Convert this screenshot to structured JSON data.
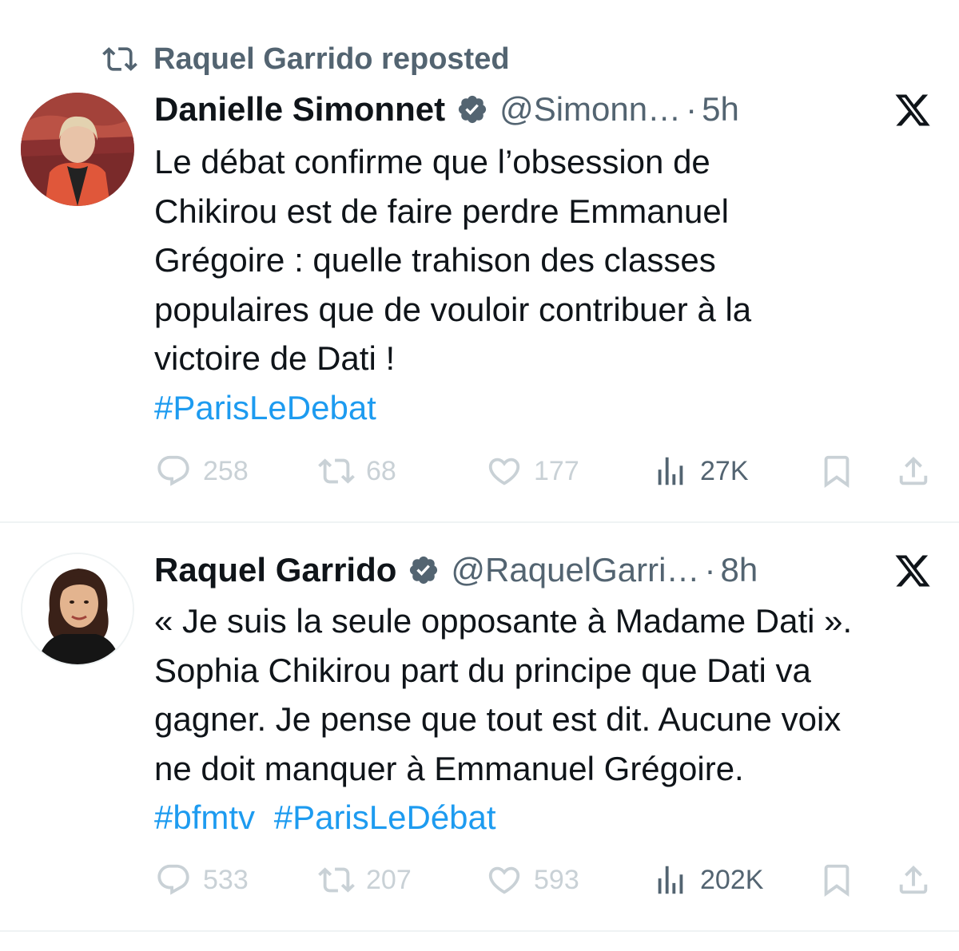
{
  "repost_banner": {
    "text": "Raquel Garrido reposted",
    "icon": "repost-icon"
  },
  "tweets": [
    {
      "author_name": "Danielle Simonnet",
      "handle": "@Simonn…",
      "separator": "·",
      "time": "5h",
      "verified": true,
      "lines": [
        "Le débat confirme que l’obsession de",
        "Chikirou est de faire perdre Emmanuel",
        "Grégoire : quelle trahison des classes",
        "populaires que de vouloir contribuer à la",
        "victoire de Dati !"
      ],
      "hashtags": [
        "#ParisLeDebat"
      ],
      "replies": "258",
      "reposts": "68",
      "likes": "177",
      "views": "27K"
    },
    {
      "author_name": "Raquel Garrido",
      "handle": "@RaquelGarri…",
      "separator": "·",
      "time": "8h",
      "verified": true,
      "lines": [
        "« Je suis la seule opposante à Madame Dati ».",
        "Sophia Chikirou part du principe que Dati va",
        "gagner. Je pense que tout est dit. Aucune voix",
        "ne doit manquer à Emmanuel Grégoire."
      ],
      "hashtags": [
        "#bfmtv",
        "#ParisLeDébat"
      ],
      "replies": "533",
      "reposts": "207",
      "likes": "593",
      "views": "202K"
    }
  ],
  "colors": {
    "text": "#0f1419",
    "secondary": "#536471",
    "link": "#1d9bf0",
    "muted_action": "#c9d1d6",
    "divider": "#eff3f4"
  }
}
